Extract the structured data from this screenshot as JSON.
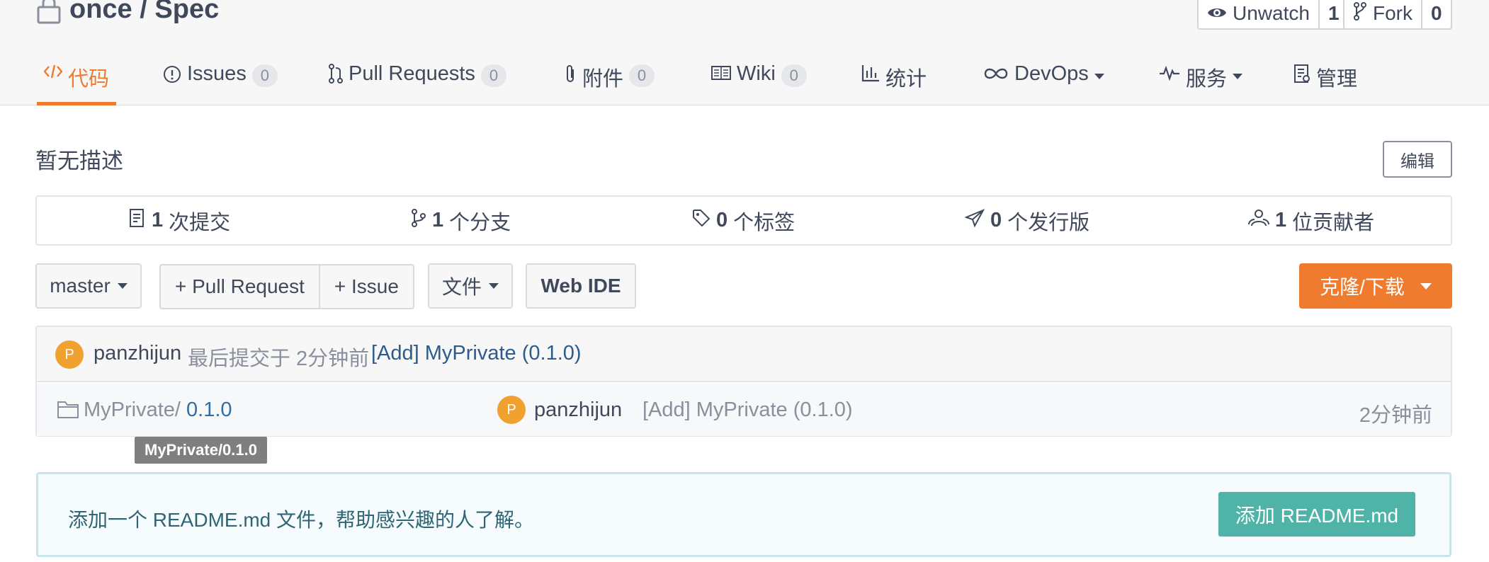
{
  "repo": {
    "owner": "once",
    "separator": " / ",
    "name": "Spec"
  },
  "watch": {
    "label": "Unwatch",
    "count": "1"
  },
  "fork": {
    "label": "Fork",
    "count": "0"
  },
  "tabs": [
    {
      "label": "代码",
      "icon": "code-icon"
    },
    {
      "label": "Issues",
      "badge": "0",
      "icon": "issue-icon"
    },
    {
      "label": "Pull Requests",
      "badge": "0",
      "icon": "pull-request-icon"
    },
    {
      "label": "附件",
      "badge": "0",
      "icon": "paperclip-icon"
    },
    {
      "label": "Wiki",
      "badge": "0",
      "icon": "book-icon"
    },
    {
      "label": "统计",
      "icon": "chart-icon"
    },
    {
      "label": "DevOps",
      "icon": "infinity-icon"
    },
    {
      "label": "服务",
      "icon": "pulse-icon"
    },
    {
      "label": "管理",
      "icon": "settings-doc-icon"
    }
  ],
  "description": "暂无描述",
  "edit_label": "编辑",
  "stats": [
    {
      "count": "1",
      "label": "次提交",
      "icon": "commit-icon"
    },
    {
      "count": "1",
      "label": "个分支",
      "icon": "branch-icon"
    },
    {
      "count": "0",
      "label": "个标签",
      "icon": "tag-icon"
    },
    {
      "count": "0",
      "label": "个发行版",
      "icon": "release-icon"
    },
    {
      "count": "1",
      "label": "位贡献者",
      "icon": "contributors-icon"
    }
  ],
  "toolbar": {
    "branch": "master",
    "new_pr": "+ Pull Request",
    "new_issue": "+ Issue",
    "file": "文件",
    "web_ide": "Web IDE",
    "clone": "克隆/下载"
  },
  "last_commit": {
    "avatar_letter": "P",
    "author": "panzhijun",
    "meta": "最后提交于 2分钟前",
    "message": "[Add] MyPrivate (0.1.0)"
  },
  "files": [
    {
      "path": "MyPrivate/",
      "version": "0.1.0",
      "avatar_letter": "P",
      "author": "panzhijun",
      "message": "[Add] MyPrivate (0.1.0)",
      "time": "2分钟前"
    }
  ],
  "tooltip": "MyPrivate/0.1.0",
  "readme": {
    "text": "添加一个 README.md 文件，帮助感兴趣的人了解。",
    "button": "添加 README.md"
  },
  "colors": {
    "accent": "#ee7b2e",
    "readme_button": "#4fb3a8",
    "avatar": "#f0a130"
  }
}
